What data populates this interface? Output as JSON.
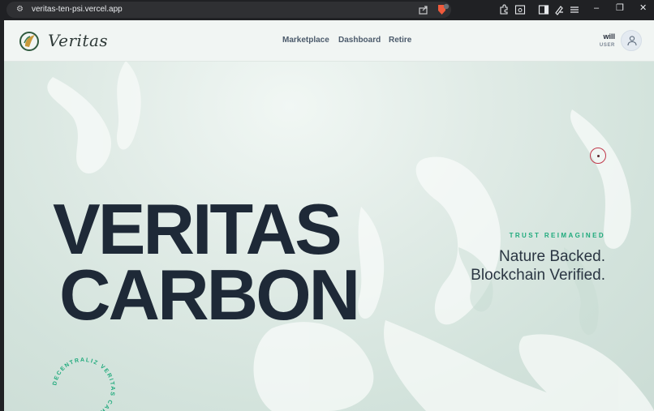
{
  "browser": {
    "url": "veritas-ten-psi.vercel.app",
    "brave_badge": "5"
  },
  "nav": {
    "brand": "Veritas",
    "links": [
      "Marketplace",
      "Dashboard",
      "Retire"
    ],
    "user_name": "will",
    "user_role": "USER"
  },
  "hero": {
    "title_line1": "VERITAS",
    "title_line2": "CARBON",
    "eyebrow": "TRUST REIMAGINED",
    "tagline_line1": "Nature Backed.",
    "tagline_line2": "Blockchain Verified.",
    "badge_text": "DECENTRALIZ VERITAS CARB S"
  },
  "colors": {
    "accent": "#1faa7c",
    "title": "#1e2937",
    "nav_link": "#4b5a6b"
  }
}
